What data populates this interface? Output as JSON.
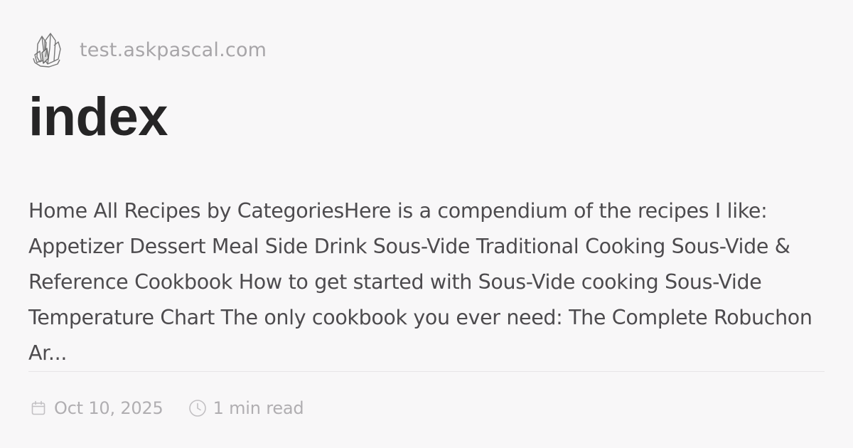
{
  "site": {
    "logo_icon": "crystal-cluster-icon",
    "domain": "test.askpascal.com"
  },
  "page": {
    "title": "index",
    "description": "Home All Recipes by CategoriesHere is a compendium of the recipes I like: Appetizer Dessert Meal Side Drink Sous-Vide Traditional Cooking Sous-Vide & Reference Cookbook How to get started with Sous-Vide cooking Sous-Vide Temperature Chart The only cookbook you ever need: The Complete Robuchon Ar..."
  },
  "meta": {
    "date_icon": "calendar-icon",
    "date": "Oct 10, 2025",
    "read_time_icon": "clock-icon",
    "read_time": "1 min read"
  },
  "colors": {
    "background": "#f8f7f8",
    "title": "#262526",
    "body_text": "#4d4b4e",
    "muted_text": "#b0aeb1"
  }
}
